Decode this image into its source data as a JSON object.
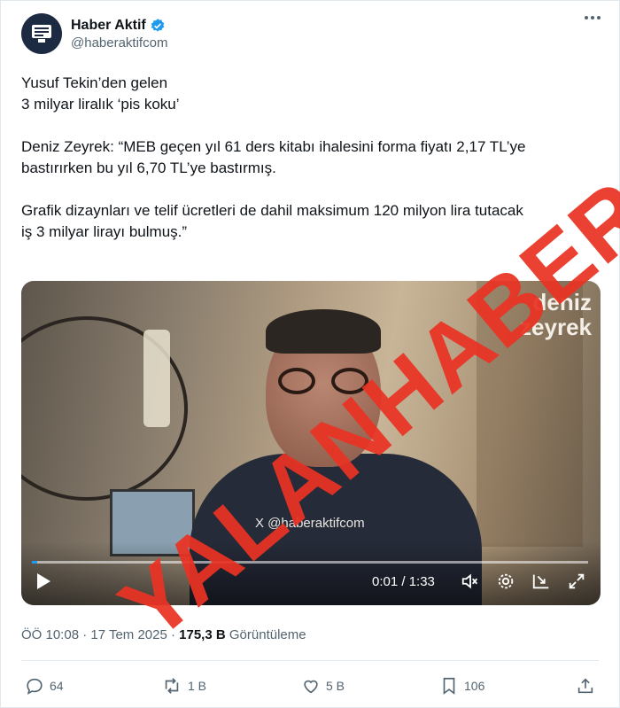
{
  "account": {
    "display_name": "Haber Aktif",
    "handle": "@haberaktifcom",
    "verified_icon": "verified-badge-icon",
    "accent_color": "#1d9bf0"
  },
  "post": {
    "headline_line1": "Yusuf Tekin’den gelen",
    "headline_line2": "3 milyar liralık ‘pis koku’",
    "quote_line1": "Deniz Zeyrek: “MEB geçen yıl 61 ders kitabı ihalesini forma fiyatı 2,17 TL’ye",
    "quote_line2": "bastırırken bu yıl 6,70 TL’ye bastırmış.",
    "detail_line1": "Grafik dizaynları ve telif ücretleri de dahil maksimum 120 milyon lira tutacak",
    "detail_line2": "iş 3 milyar lirayı bulmuş.”"
  },
  "video": {
    "brand_line1": "deniz",
    "brand_line2": "zeyrek",
    "watermark": "X @haberaktifcom",
    "time": "0:01 / 1:33",
    "progress": 0.01
  },
  "stamp": {
    "text": "YALANHABER",
    "color": "#ea3324"
  },
  "meta": {
    "time": "ÖÖ 10:08 · 17 Tem 2025 · ",
    "views": "175,3 B",
    "views_label": "Görüntüleme"
  },
  "actions": {
    "replies": "64",
    "reposts": "1 B",
    "likes": "5 B",
    "bookmarks": "106"
  }
}
